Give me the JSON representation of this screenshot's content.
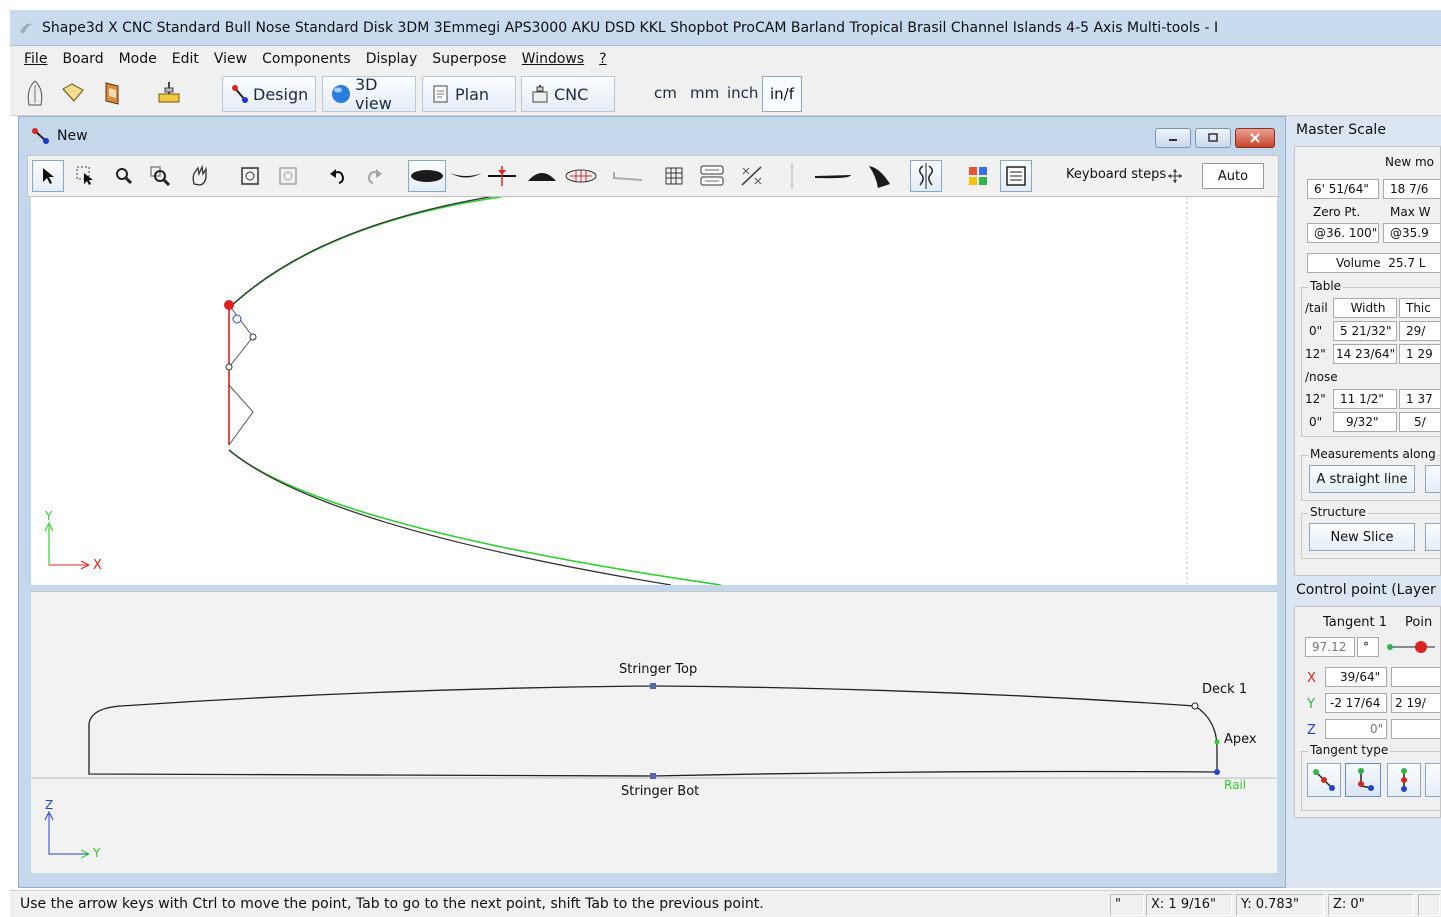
{
  "window": {
    "title": "Shape3d X CNC  Standard Bull Nose Standard Disk 3DM 3Emmegi APS3000 AKU DSD KKL Shopbot ProCAM Barland Tropical Brasil Channel Islands 4-5 Axis Multi-tools - I"
  },
  "menu": {
    "items": [
      "File",
      "Board",
      "Mode",
      "Edit",
      "View",
      "Components",
      "Display",
      "Superpose",
      "Windows",
      "?"
    ]
  },
  "toolbar": {
    "design_label": "Design",
    "view3d_label": "3D view",
    "plan_label": "Plan",
    "cnc_label": "CNC",
    "units": [
      "cm",
      "mm",
      "inch"
    ],
    "unit_selected": "in/f"
  },
  "design_window": {
    "title": "New",
    "keyboard_steps_label": "Keyboard steps",
    "auto_label": "Auto"
  },
  "top_view": {
    "axis_x": "X",
    "axis_y": "Y"
  },
  "side_view": {
    "stringer_top": "Stringer Top",
    "stringer_bot": "Stringer Bot",
    "deck": "Deck 1",
    "apex": "Apex",
    "rail": "Rail",
    "axis_z": "Z",
    "axis_y": "Y"
  },
  "master_scale": {
    "title": "Master Scale",
    "new_label": "New mo",
    "length": "6' 51/64\"",
    "width_val": "18 7/6",
    "zero_pt_label": "Zero Pt.",
    "max_w_label": "Max W",
    "zero_pt_val": "@36. 100\"",
    "max_w_val": "@35.9",
    "volume_label": "Volume",
    "volume_val": "25.7 L",
    "table_label": "Table",
    "tail_label": "/tail",
    "nose_label": "/nose",
    "col_width": "Width",
    "col_thick": "Thic",
    "rows_tail": [
      {
        "pos": "0\"",
        "width": "5 21/32\"",
        "thick": "29/"
      },
      {
        "pos": "12\"",
        "width": "14 23/64\"",
        "thick": "1 29"
      }
    ],
    "rows_nose": [
      {
        "pos": "12\"",
        "width": "11 1/2\"",
        "thick": "1 37"
      },
      {
        "pos": "0\"",
        "width": "9/32\"",
        "thick": "5/"
      }
    ],
    "measurements_label": "Measurements along",
    "straight_line_btn": "A straight line",
    "structure_label": "Structure",
    "new_slice_btn": "New Slice"
  },
  "control_point": {
    "title": "Control point (Layer",
    "tangent1_label": "Tangent 1",
    "point_label": "Poin",
    "angle_val": "97.12",
    "angle_unit": "°",
    "x_label": "X",
    "y_label": "Y",
    "z_label": "Z",
    "x_val": "39/64\"",
    "y_val": "-2 17/64",
    "y_val2": "2 19/",
    "z_val": "0\"",
    "tangent_type_label": "Tangent type"
  },
  "status": {
    "message": "Use the arrow keys with Ctrl to move the point, Tab to go to the next point, shift Tab to the previous point.",
    "unit_cell": "\"",
    "x": "X: 1 9/16\"",
    "y": "Y: 0.783\"",
    "z": "Z: 0\""
  },
  "colors": {
    "accent": "#c5d7eb",
    "curve_green": "#22cc22",
    "curve_dark": "#333333",
    "control_red": "#dd2222",
    "control_blue": "#2244cc"
  }
}
